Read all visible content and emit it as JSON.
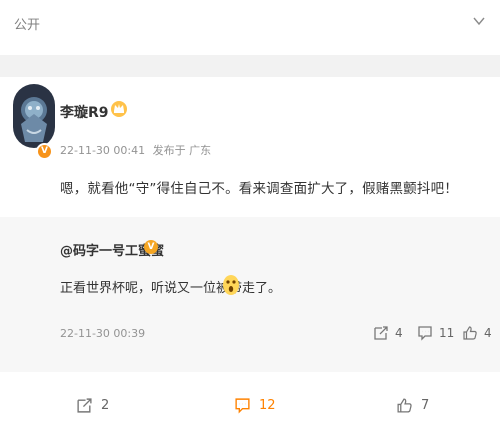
{
  "header": {
    "visibility": "公开"
  },
  "post": {
    "author": "李璇R9",
    "verified_badge": "V",
    "time": "22-11-30 00:41",
    "source": "发布于 广东",
    "text": "嗯，就看他“守”得住自己不。看来调查面扩大了，假赌黑颤抖吧！"
  },
  "quoted": {
    "author": "@码字一号工蜜蜜",
    "badge": "V",
    "text": "正看世界杯呢，听说又一位被带走了。",
    "time": "22-11-30 00:39",
    "reposts": "4",
    "comments": "11",
    "likes": "4"
  },
  "bottom": {
    "reposts": "2",
    "comments": "12",
    "likes": "7"
  },
  "colors": {
    "accent": "#ff8200",
    "muted": "#939393",
    "panel": "#f7f7f7"
  }
}
